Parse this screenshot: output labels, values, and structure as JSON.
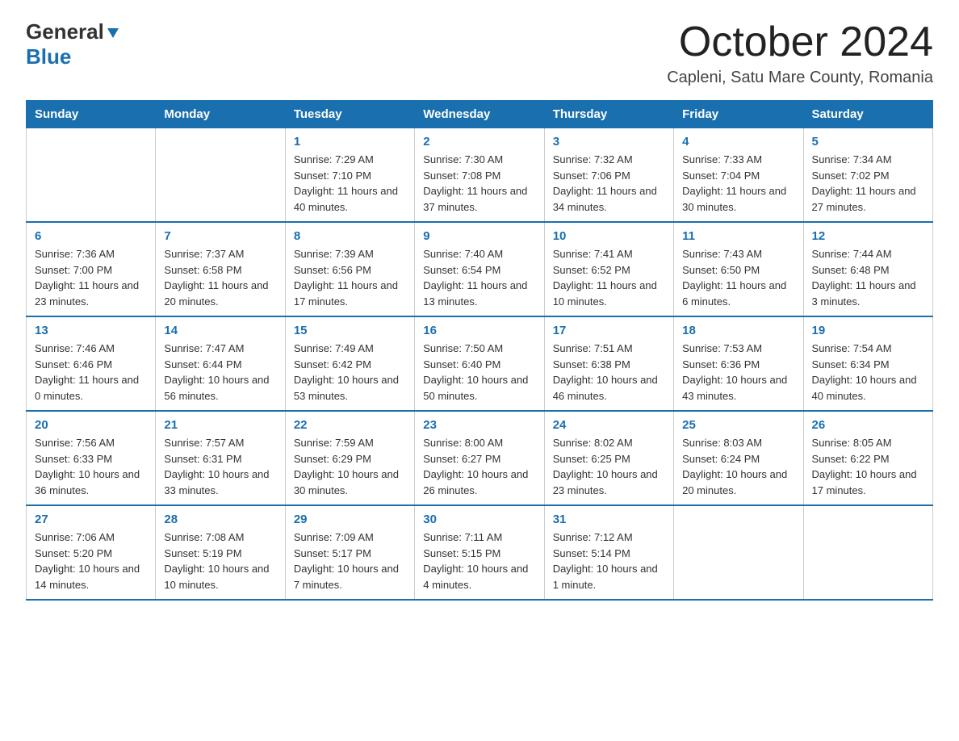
{
  "header": {
    "logo_general": "General",
    "logo_blue": "Blue",
    "month_year": "October 2024",
    "location": "Capleni, Satu Mare County, Romania"
  },
  "days_of_week": [
    "Sunday",
    "Monday",
    "Tuesday",
    "Wednesday",
    "Thursday",
    "Friday",
    "Saturday"
  ],
  "weeks": [
    [
      {
        "day": "",
        "sunrise": "",
        "sunset": "",
        "daylight": ""
      },
      {
        "day": "",
        "sunrise": "",
        "sunset": "",
        "daylight": ""
      },
      {
        "day": "1",
        "sunrise": "Sunrise: 7:29 AM",
        "sunset": "Sunset: 7:10 PM",
        "daylight": "Daylight: 11 hours and 40 minutes."
      },
      {
        "day": "2",
        "sunrise": "Sunrise: 7:30 AM",
        "sunset": "Sunset: 7:08 PM",
        "daylight": "Daylight: 11 hours and 37 minutes."
      },
      {
        "day": "3",
        "sunrise": "Sunrise: 7:32 AM",
        "sunset": "Sunset: 7:06 PM",
        "daylight": "Daylight: 11 hours and 34 minutes."
      },
      {
        "day": "4",
        "sunrise": "Sunrise: 7:33 AM",
        "sunset": "Sunset: 7:04 PM",
        "daylight": "Daylight: 11 hours and 30 minutes."
      },
      {
        "day": "5",
        "sunrise": "Sunrise: 7:34 AM",
        "sunset": "Sunset: 7:02 PM",
        "daylight": "Daylight: 11 hours and 27 minutes."
      }
    ],
    [
      {
        "day": "6",
        "sunrise": "Sunrise: 7:36 AM",
        "sunset": "Sunset: 7:00 PM",
        "daylight": "Daylight: 11 hours and 23 minutes."
      },
      {
        "day": "7",
        "sunrise": "Sunrise: 7:37 AM",
        "sunset": "Sunset: 6:58 PM",
        "daylight": "Daylight: 11 hours and 20 minutes."
      },
      {
        "day": "8",
        "sunrise": "Sunrise: 7:39 AM",
        "sunset": "Sunset: 6:56 PM",
        "daylight": "Daylight: 11 hours and 17 minutes."
      },
      {
        "day": "9",
        "sunrise": "Sunrise: 7:40 AM",
        "sunset": "Sunset: 6:54 PM",
        "daylight": "Daylight: 11 hours and 13 minutes."
      },
      {
        "day": "10",
        "sunrise": "Sunrise: 7:41 AM",
        "sunset": "Sunset: 6:52 PM",
        "daylight": "Daylight: 11 hours and 10 minutes."
      },
      {
        "day": "11",
        "sunrise": "Sunrise: 7:43 AM",
        "sunset": "Sunset: 6:50 PM",
        "daylight": "Daylight: 11 hours and 6 minutes."
      },
      {
        "day": "12",
        "sunrise": "Sunrise: 7:44 AM",
        "sunset": "Sunset: 6:48 PM",
        "daylight": "Daylight: 11 hours and 3 minutes."
      }
    ],
    [
      {
        "day": "13",
        "sunrise": "Sunrise: 7:46 AM",
        "sunset": "Sunset: 6:46 PM",
        "daylight": "Daylight: 11 hours and 0 minutes."
      },
      {
        "day": "14",
        "sunrise": "Sunrise: 7:47 AM",
        "sunset": "Sunset: 6:44 PM",
        "daylight": "Daylight: 10 hours and 56 minutes."
      },
      {
        "day": "15",
        "sunrise": "Sunrise: 7:49 AM",
        "sunset": "Sunset: 6:42 PM",
        "daylight": "Daylight: 10 hours and 53 minutes."
      },
      {
        "day": "16",
        "sunrise": "Sunrise: 7:50 AM",
        "sunset": "Sunset: 6:40 PM",
        "daylight": "Daylight: 10 hours and 50 minutes."
      },
      {
        "day": "17",
        "sunrise": "Sunrise: 7:51 AM",
        "sunset": "Sunset: 6:38 PM",
        "daylight": "Daylight: 10 hours and 46 minutes."
      },
      {
        "day": "18",
        "sunrise": "Sunrise: 7:53 AM",
        "sunset": "Sunset: 6:36 PM",
        "daylight": "Daylight: 10 hours and 43 minutes."
      },
      {
        "day": "19",
        "sunrise": "Sunrise: 7:54 AM",
        "sunset": "Sunset: 6:34 PM",
        "daylight": "Daylight: 10 hours and 40 minutes."
      }
    ],
    [
      {
        "day": "20",
        "sunrise": "Sunrise: 7:56 AM",
        "sunset": "Sunset: 6:33 PM",
        "daylight": "Daylight: 10 hours and 36 minutes."
      },
      {
        "day": "21",
        "sunrise": "Sunrise: 7:57 AM",
        "sunset": "Sunset: 6:31 PM",
        "daylight": "Daylight: 10 hours and 33 minutes."
      },
      {
        "day": "22",
        "sunrise": "Sunrise: 7:59 AM",
        "sunset": "Sunset: 6:29 PM",
        "daylight": "Daylight: 10 hours and 30 minutes."
      },
      {
        "day": "23",
        "sunrise": "Sunrise: 8:00 AM",
        "sunset": "Sunset: 6:27 PM",
        "daylight": "Daylight: 10 hours and 26 minutes."
      },
      {
        "day": "24",
        "sunrise": "Sunrise: 8:02 AM",
        "sunset": "Sunset: 6:25 PM",
        "daylight": "Daylight: 10 hours and 23 minutes."
      },
      {
        "day": "25",
        "sunrise": "Sunrise: 8:03 AM",
        "sunset": "Sunset: 6:24 PM",
        "daylight": "Daylight: 10 hours and 20 minutes."
      },
      {
        "day": "26",
        "sunrise": "Sunrise: 8:05 AM",
        "sunset": "Sunset: 6:22 PM",
        "daylight": "Daylight: 10 hours and 17 minutes."
      }
    ],
    [
      {
        "day": "27",
        "sunrise": "Sunrise: 7:06 AM",
        "sunset": "Sunset: 5:20 PM",
        "daylight": "Daylight: 10 hours and 14 minutes."
      },
      {
        "day": "28",
        "sunrise": "Sunrise: 7:08 AM",
        "sunset": "Sunset: 5:19 PM",
        "daylight": "Daylight: 10 hours and 10 minutes."
      },
      {
        "day": "29",
        "sunrise": "Sunrise: 7:09 AM",
        "sunset": "Sunset: 5:17 PM",
        "daylight": "Daylight: 10 hours and 7 minutes."
      },
      {
        "day": "30",
        "sunrise": "Sunrise: 7:11 AM",
        "sunset": "Sunset: 5:15 PM",
        "daylight": "Daylight: 10 hours and 4 minutes."
      },
      {
        "day": "31",
        "sunrise": "Sunrise: 7:12 AM",
        "sunset": "Sunset: 5:14 PM",
        "daylight": "Daylight: 10 hours and 1 minute."
      },
      {
        "day": "",
        "sunrise": "",
        "sunset": "",
        "daylight": ""
      },
      {
        "day": "",
        "sunrise": "",
        "sunset": "",
        "daylight": ""
      }
    ]
  ]
}
